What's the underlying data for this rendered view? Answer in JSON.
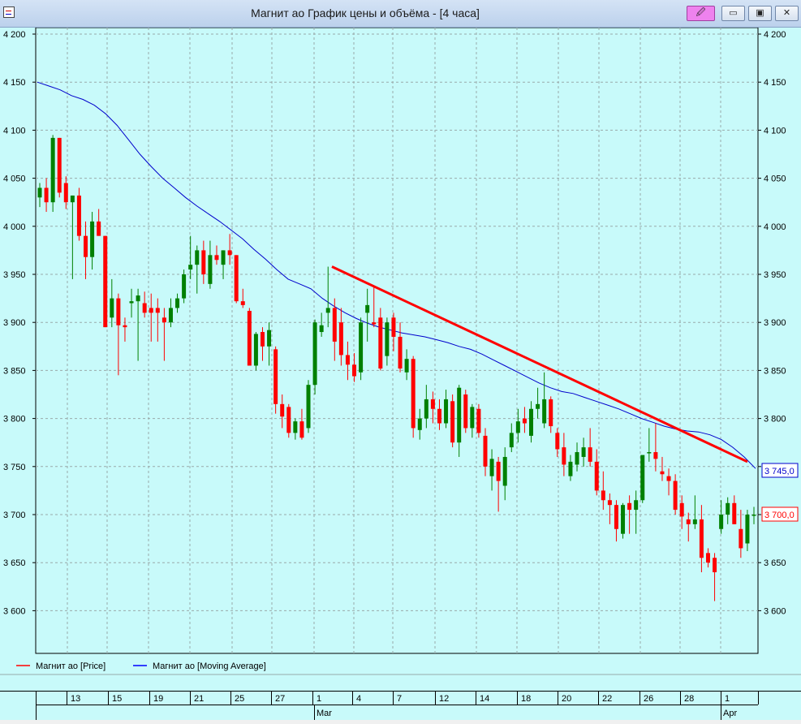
{
  "window": {
    "title": "Магнит ао График цены и объёма - [4 часа]",
    "buttons": {
      "pin": "🖉",
      "minimize": "▭",
      "maximize": "▣",
      "close": "✕"
    }
  },
  "legend": {
    "items": [
      {
        "label": "Магнит ао [Price]",
        "color": "#ff0000"
      },
      {
        "label": "Магнит ао [Moving Average]",
        "color": "#0000ff"
      }
    ]
  },
  "price_tags": {
    "ma": "3 745,0",
    "price": "3 700,0"
  },
  "time_axis": {
    "days": [
      "13",
      "15",
      "19",
      "21",
      "25",
      "27",
      "1",
      "4",
      "7",
      "12",
      "14",
      "18",
      "20",
      "22",
      "26",
      "28",
      "1"
    ],
    "months": [
      "Mar",
      "Apr"
    ]
  },
  "chart_data": {
    "type": "candlestick",
    "title": "",
    "y_ticks": [
      "4 200",
      "4 150",
      "4 100",
      "4 050",
      "4 000",
      "3 950",
      "3 900",
      "3 850",
      "3 800",
      "3 750",
      "3 700",
      "3 650",
      "3 600"
    ],
    "ylim": [
      3550,
      4205
    ],
    "grid": true,
    "colors": {
      "up": "#008000",
      "down": "#ff0000",
      "ma": "#0000cc",
      "trendline": "#ff0000"
    },
    "candles": [
      {
        "o": 4030,
        "h": 4045,
        "l": 4020,
        "c": 4040
      },
      {
        "o": 4040,
        "h": 4050,
        "l": 4015,
        "c": 4025
      },
      {
        "o": 4025,
        "h": 4095,
        "l": 4015,
        "c": 4092
      },
      {
        "o": 4092,
        "h": 4092,
        "l": 4030,
        "c": 4035
      },
      {
        "o": 4045,
        "h": 4052,
        "l": 4018,
        "c": 4025
      },
      {
        "o": 4025,
        "h": 4032,
        "l": 3945,
        "c": 4032
      },
      {
        "o": 4032,
        "h": 4040,
        "l": 3985,
        "c": 3990
      },
      {
        "o": 3990,
        "h": 4005,
        "l": 3945,
        "c": 3968
      },
      {
        "o": 3968,
        "h": 4015,
        "l": 3955,
        "c": 4005
      },
      {
        "o": 4005,
        "h": 4018,
        "l": 3990,
        "c": 3990
      },
      {
        "o": 3990,
        "h": 3990,
        "l": 3895,
        "c": 3895
      },
      {
        "o": 3905,
        "h": 3945,
        "l": 3895,
        "c": 3925
      },
      {
        "o": 3925,
        "h": 3930,
        "l": 3845,
        "c": 3897
      },
      {
        "o": 3897,
        "h": 3905,
        "l": 3880,
        "c": 3895
      },
      {
        "o": 3920,
        "h": 3935,
        "l": 3905,
        "c": 3922
      },
      {
        "o": 3922,
        "h": 3935,
        "l": 3860,
        "c": 3928
      },
      {
        "o": 3920,
        "h": 3932,
        "l": 3905,
        "c": 3910
      },
      {
        "o": 3915,
        "h": 3930,
        "l": 3880,
        "c": 3910
      },
      {
        "o": 3915,
        "h": 3925,
        "l": 3880,
        "c": 3910
      },
      {
        "o": 3905,
        "h": 3915,
        "l": 3860,
        "c": 3900
      },
      {
        "o": 3900,
        "h": 3925,
        "l": 3895,
        "c": 3915
      },
      {
        "o": 3915,
        "h": 3930,
        "l": 3910,
        "c": 3925
      },
      {
        "o": 3925,
        "h": 3955,
        "l": 3920,
        "c": 3950
      },
      {
        "o": 3955,
        "h": 3990,
        "l": 3945,
        "c": 3960
      },
      {
        "o": 3960,
        "h": 3980,
        "l": 3930,
        "c": 3975
      },
      {
        "o": 3975,
        "h": 3985,
        "l": 3940,
        "c": 3950
      },
      {
        "o": 3940,
        "h": 3985,
        "l": 3935,
        "c": 3970
      },
      {
        "o": 3970,
        "h": 3980,
        "l": 3960,
        "c": 3965
      },
      {
        "o": 3960,
        "h": 3975,
        "l": 3945,
        "c": 3975
      },
      {
        "o": 3975,
        "h": 3992,
        "l": 3960,
        "c": 3970
      },
      {
        "o": 3970,
        "h": 3970,
        "l": 3920,
        "c": 3922
      },
      {
        "o": 3922,
        "h": 3935,
        "l": 3915,
        "c": 3918
      },
      {
        "o": 3912,
        "h": 3915,
        "l": 3855,
        "c": 3855
      },
      {
        "o": 3855,
        "h": 3890,
        "l": 3850,
        "c": 3888
      },
      {
        "o": 3890,
        "h": 3895,
        "l": 3860,
        "c": 3875
      },
      {
        "o": 3875,
        "h": 3900,
        "l": 3855,
        "c": 3892
      },
      {
        "o": 3872,
        "h": 3875,
        "l": 3805,
        "c": 3815
      },
      {
        "o": 3815,
        "h": 3825,
        "l": 3790,
        "c": 3802
      },
      {
        "o": 3812,
        "h": 3815,
        "l": 3780,
        "c": 3785
      },
      {
        "o": 3785,
        "h": 3800,
        "l": 3778,
        "c": 3797
      },
      {
        "o": 3797,
        "h": 3810,
        "l": 3778,
        "c": 3780
      },
      {
        "o": 3790,
        "h": 3840,
        "l": 3785,
        "c": 3835
      },
      {
        "o": 3835,
        "h": 3903,
        "l": 3825,
        "c": 3900
      },
      {
        "o": 3890,
        "h": 3910,
        "l": 3885,
        "c": 3897
      },
      {
        "o": 3910,
        "h": 3958,
        "l": 3895,
        "c": 3915
      },
      {
        "o": 3915,
        "h": 3925,
        "l": 3860,
        "c": 3880
      },
      {
        "o": 3900,
        "h": 3915,
        "l": 3855,
        "c": 3866
      },
      {
        "o": 3866,
        "h": 3880,
        "l": 3840,
        "c": 3856
      },
      {
        "o": 3856,
        "h": 3868,
        "l": 3838,
        "c": 3844
      },
      {
        "o": 3848,
        "h": 3905,
        "l": 3840,
        "c": 3900
      },
      {
        "o": 3910,
        "h": 3935,
        "l": 3880,
        "c": 3918
      },
      {
        "o": 3900,
        "h": 3938,
        "l": 3895,
        "c": 3898
      },
      {
        "o": 3905,
        "h": 3915,
        "l": 3850,
        "c": 3852
      },
      {
        "o": 3865,
        "h": 3905,
        "l": 3855,
        "c": 3900
      },
      {
        "o": 3905,
        "h": 3910,
        "l": 3870,
        "c": 3885
      },
      {
        "o": 3885,
        "h": 3900,
        "l": 3848,
        "c": 3852
      },
      {
        "o": 3848,
        "h": 3872,
        "l": 3840,
        "c": 3862
      },
      {
        "o": 3862,
        "h": 3865,
        "l": 3780,
        "c": 3790
      },
      {
        "o": 3788,
        "h": 3810,
        "l": 3778,
        "c": 3800
      },
      {
        "o": 3800,
        "h": 3835,
        "l": 3790,
        "c": 3820
      },
      {
        "o": 3820,
        "h": 3828,
        "l": 3795,
        "c": 3810
      },
      {
        "o": 3810,
        "h": 3820,
        "l": 3788,
        "c": 3795
      },
      {
        "o": 3795,
        "h": 3830,
        "l": 3790,
        "c": 3820
      },
      {
        "o": 3818,
        "h": 3825,
        "l": 3770,
        "c": 3775
      },
      {
        "o": 3775,
        "h": 3835,
        "l": 3760,
        "c": 3832
      },
      {
        "o": 3825,
        "h": 3830,
        "l": 3785,
        "c": 3790
      },
      {
        "o": 3790,
        "h": 3815,
        "l": 3780,
        "c": 3812
      },
      {
        "o": 3810,
        "h": 3815,
        "l": 3780,
        "c": 3785
      },
      {
        "o": 3782,
        "h": 3790,
        "l": 3740,
        "c": 3750
      },
      {
        "o": 3740,
        "h": 3768,
        "l": 3725,
        "c": 3758
      },
      {
        "o": 3755,
        "h": 3760,
        "l": 3703,
        "c": 3735
      },
      {
        "o": 3730,
        "h": 3770,
        "l": 3715,
        "c": 3760
      },
      {
        "o": 3770,
        "h": 3795,
        "l": 3765,
        "c": 3785
      },
      {
        "o": 3785,
        "h": 3810,
        "l": 3775,
        "c": 3797
      },
      {
        "o": 3800,
        "h": 3812,
        "l": 3785,
        "c": 3795
      },
      {
        "o": 3782,
        "h": 3818,
        "l": 3775,
        "c": 3810
      },
      {
        "o": 3810,
        "h": 3832,
        "l": 3800,
        "c": 3815
      },
      {
        "o": 3795,
        "h": 3848,
        "l": 3790,
        "c": 3820
      },
      {
        "o": 3820,
        "h": 3823,
        "l": 3785,
        "c": 3792
      },
      {
        "o": 3785,
        "h": 3790,
        "l": 3760,
        "c": 3768
      },
      {
        "o": 3770,
        "h": 3785,
        "l": 3740,
        "c": 3752
      },
      {
        "o": 3740,
        "h": 3762,
        "l": 3735,
        "c": 3755
      },
      {
        "o": 3752,
        "h": 3775,
        "l": 3745,
        "c": 3765
      },
      {
        "o": 3760,
        "h": 3780,
        "l": 3750,
        "c": 3770
      },
      {
        "o": 3770,
        "h": 3790,
        "l": 3750,
        "c": 3755
      },
      {
        "o": 3755,
        "h": 3768,
        "l": 3720,
        "c": 3725
      },
      {
        "o": 3725,
        "h": 3745,
        "l": 3705,
        "c": 3715
      },
      {
        "o": 3715,
        "h": 3722,
        "l": 3690,
        "c": 3710
      },
      {
        "o": 3710,
        "h": 3715,
        "l": 3672,
        "c": 3685
      },
      {
        "o": 3680,
        "h": 3712,
        "l": 3675,
        "c": 3710
      },
      {
        "o": 3712,
        "h": 3720,
        "l": 3680,
        "c": 3705
      },
      {
        "o": 3705,
        "h": 3725,
        "l": 3680,
        "c": 3715
      },
      {
        "o": 3715,
        "h": 3760,
        "l": 3712,
        "c": 3762
      },
      {
        "o": 3765,
        "h": 3790,
        "l": 3755,
        "c": 3765
      },
      {
        "o": 3765,
        "h": 3795,
        "l": 3745,
        "c": 3758
      },
      {
        "o": 3745,
        "h": 3760,
        "l": 3735,
        "c": 3742
      },
      {
        "o": 3740,
        "h": 3748,
        "l": 3720,
        "c": 3735
      },
      {
        "o": 3735,
        "h": 3742,
        "l": 3700,
        "c": 3705
      },
      {
        "o": 3712,
        "h": 3720,
        "l": 3685,
        "c": 3698
      },
      {
        "o": 3695,
        "h": 3702,
        "l": 3672,
        "c": 3690
      },
      {
        "o": 3690,
        "h": 3720,
        "l": 3685,
        "c": 3695
      },
      {
        "o": 3695,
        "h": 3710,
        "l": 3640,
        "c": 3655
      },
      {
        "o": 3660,
        "h": 3665,
        "l": 3645,
        "c": 3650
      },
      {
        "o": 3655,
        "h": 3660,
        "l": 3610,
        "c": 3640
      },
      {
        "o": 3685,
        "h": 3715,
        "l": 3680,
        "c": 3700
      },
      {
        "o": 3700,
        "h": 3718,
        "l": 3690,
        "c": 3712
      },
      {
        "o": 3712,
        "h": 3720,
        "l": 3690,
        "c": 3690
      },
      {
        "o": 3685,
        "h": 3705,
        "l": 3655,
        "c": 3665
      },
      {
        "o": 3670,
        "h": 3705,
        "l": 3662,
        "c": 3700
      },
      {
        "o": 3700,
        "h": 3708,
        "l": 3690,
        "c": 3700
      }
    ],
    "moving_average": [
      4150,
      4146,
      4142,
      4136,
      4132,
      4126,
      4117,
      4105,
      4090,
      4075,
      4062,
      4050,
      4040,
      4030,
      4021,
      4013,
      4005,
      3996,
      3987,
      3976,
      3966,
      3955,
      3945,
      3940,
      3935,
      3925,
      3917,
      3910,
      3904,
      3899,
      3895,
      3892,
      3889,
      3887,
      3885,
      3882,
      3879,
      3875,
      3872,
      3867,
      3861,
      3855,
      3849,
      3843,
      3837,
      3832,
      3828,
      3826,
      3822,
      3818,
      3814,
      3810,
      3805,
      3800,
      3796,
      3792,
      3789,
      3787,
      3786,
      3783,
      3778,
      3770,
      3760,
      3748
    ],
    "trendline": {
      "start": 3958,
      "end": 3755
    }
  }
}
